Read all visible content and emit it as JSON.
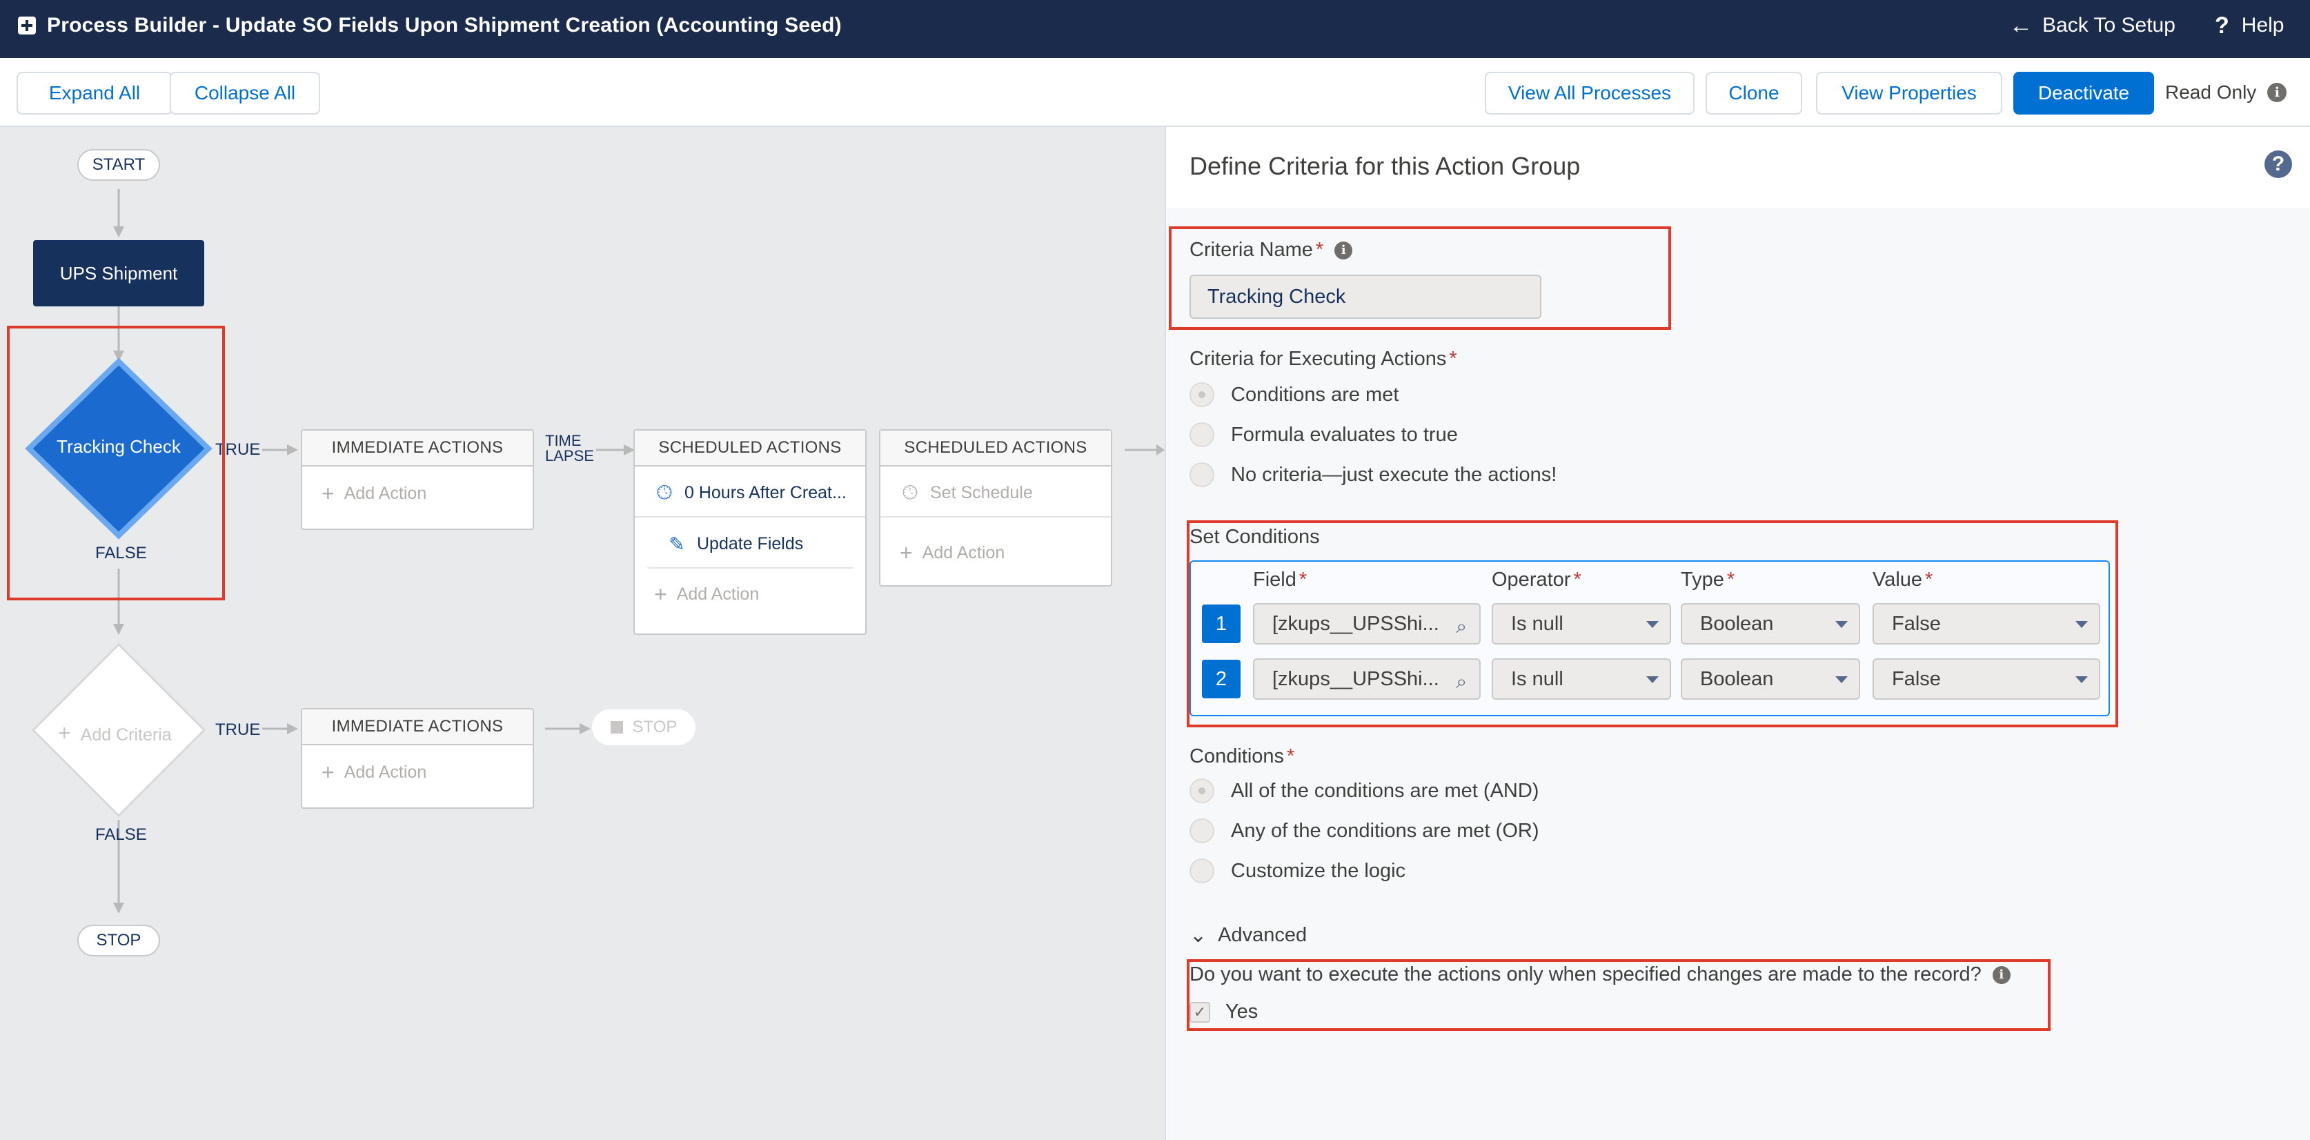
{
  "header": {
    "title": "Process Builder - Update SO Fields Upon Shipment Creation (Accounting Seed)",
    "back_label": "Back To Setup",
    "help_label": "Help"
  },
  "toolbar": {
    "expand_all": "Expand All",
    "collapse_all": "Collapse All",
    "view_all_processes": "View All Processes",
    "clone": "Clone",
    "view_properties": "View Properties",
    "deactivate": "Deactivate",
    "read_only": "Read Only"
  },
  "canvas": {
    "start": "START",
    "object": "UPS Shipment",
    "criteria1": "Tracking Check",
    "true1": "TRUE",
    "false1": "FALSE",
    "immediate_actions_1": "IMMEDIATE ACTIONS",
    "add_action": "Add Action",
    "time_lapse_1": "TIME",
    "time_lapse_2": "LAPSE",
    "scheduled_actions_1": "SCHEDULED ACTIONS",
    "schedule_1": "0 Hours After Creat...",
    "update_fields": "Update Fields",
    "scheduled_actions_2": "SCHEDULED ACTIONS",
    "set_schedule": "Set Schedule",
    "add_criteria": "Add Criteria",
    "true2": "TRUE",
    "false2": "FALSE",
    "immediate_actions_2": "IMMEDIATE ACTIONS",
    "stop_muted": "STOP",
    "stop": "STOP"
  },
  "panel": {
    "title": "Define Criteria for this Action Group",
    "criteria_name_label": "Criteria Name",
    "criteria_name_value": "Tracking Check",
    "executing_label": "Criteria for Executing Actions",
    "exec_options": [
      "Conditions are met",
      "Formula evaluates to true",
      "No criteria—just execute the actions!"
    ],
    "set_conditions_label": "Set Conditions",
    "columns": {
      "field": "Field",
      "operator": "Operator",
      "type": "Type",
      "value": "Value"
    },
    "rows": [
      {
        "num": "1",
        "field": "[zkups__UPSShi...",
        "operator": "Is null",
        "type": "Boolean",
        "value": "False"
      },
      {
        "num": "2",
        "field": "[zkups__UPSShi...",
        "operator": "Is null",
        "type": "Boolean",
        "value": "False"
      }
    ],
    "conditions_label": "Conditions",
    "cond_options": [
      "All of the conditions are met (AND)",
      "Any of the conditions are met (OR)",
      "Customize the logic"
    ],
    "advanced_label": "Advanced",
    "advanced_question": "Do you want to execute the actions only when specified changes are made to the record?",
    "yes_label": "Yes"
  },
  "colors": {
    "header_bg": "#1b2b4b",
    "brand": "#0070d2",
    "highlight": "#e03a2d"
  }
}
